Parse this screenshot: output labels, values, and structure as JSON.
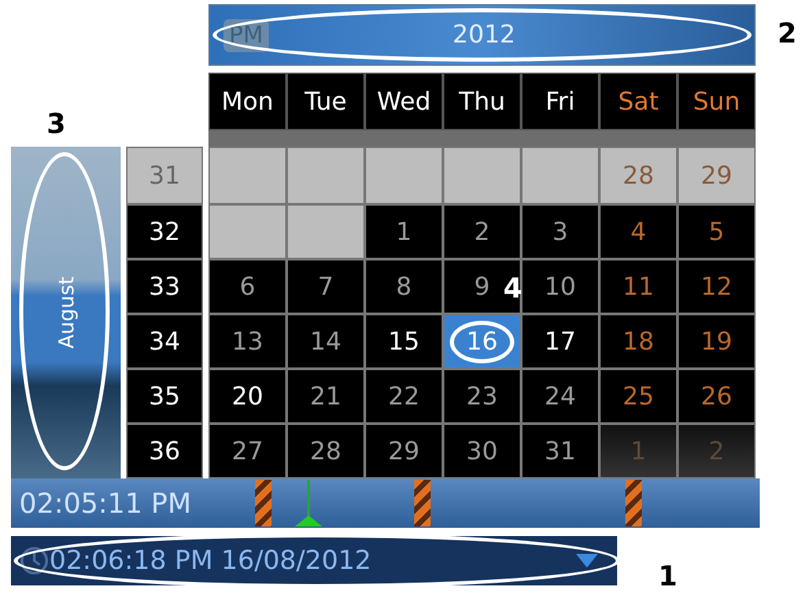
{
  "year_bar": {
    "am_pm": "PM",
    "year": "2012"
  },
  "weekdays": [
    {
      "label": "Mon",
      "kind": "weekday"
    },
    {
      "label": "Tue",
      "kind": "weekday"
    },
    {
      "label": "Wed",
      "kind": "weekday"
    },
    {
      "label": "Thu",
      "kind": "weekday"
    },
    {
      "label": "Fri",
      "kind": "weekday"
    },
    {
      "label": "Sat",
      "kind": "weekend"
    },
    {
      "label": "Sun",
      "kind": "weekend"
    }
  ],
  "month": "August",
  "weeks": [
    {
      "number": "31",
      "current": false,
      "days": [
        {
          "kind": "blank",
          "selected": false
        },
        {
          "kind": "blank",
          "selected": false
        },
        {
          "kind": "blank",
          "selected": false
        },
        {
          "kind": "blank",
          "selected": false
        },
        {
          "kind": "blank",
          "selected": false
        },
        {
          "day": "28",
          "kind": "faded",
          "selected": false
        },
        {
          "day": "29",
          "kind": "faded",
          "selected": false
        }
      ]
    },
    {
      "number": "32",
      "current": true,
      "days": [
        {
          "kind": "blank",
          "selected": false
        },
        {
          "kind": "blank",
          "selected": false
        },
        {
          "day": "1",
          "kind": "dim",
          "selected": false
        },
        {
          "day": "2",
          "kind": "dim",
          "selected": false
        },
        {
          "day": "3",
          "kind": "dim",
          "selected": false
        },
        {
          "day": "4",
          "kind": "weekend",
          "selected": false
        },
        {
          "day": "5",
          "kind": "weekend",
          "selected": false
        }
      ]
    },
    {
      "number": "33",
      "current": true,
      "days": [
        {
          "day": "6",
          "kind": "dim",
          "selected": false
        },
        {
          "day": "7",
          "kind": "dim",
          "selected": false
        },
        {
          "day": "8",
          "kind": "dim",
          "selected": false
        },
        {
          "day": "9",
          "kind": "dim",
          "selected": false
        },
        {
          "day": "10",
          "kind": "dim",
          "selected": false
        },
        {
          "day": "11",
          "kind": "weekend",
          "selected": false
        },
        {
          "day": "12",
          "kind": "weekend",
          "selected": false
        }
      ]
    },
    {
      "number": "34",
      "current": true,
      "days": [
        {
          "day": "13",
          "kind": "dim",
          "selected": false
        },
        {
          "day": "14",
          "kind": "dim",
          "selected": false
        },
        {
          "day": "15",
          "kind": "bright",
          "selected": false
        },
        {
          "day": "16",
          "kind": "dim",
          "selected": true
        },
        {
          "day": "17",
          "kind": "bright",
          "selected": false
        },
        {
          "day": "18",
          "kind": "weekend",
          "selected": false
        },
        {
          "day": "19",
          "kind": "weekend",
          "selected": false
        }
      ]
    },
    {
      "number": "35",
      "current": true,
      "days": [
        {
          "day": "20",
          "kind": "bright",
          "selected": false
        },
        {
          "day": "21",
          "kind": "dim",
          "selected": false
        },
        {
          "day": "22",
          "kind": "dim",
          "selected": false
        },
        {
          "day": "23",
          "kind": "dim",
          "selected": false
        },
        {
          "day": "24",
          "kind": "dim",
          "selected": false
        },
        {
          "day": "25",
          "kind": "weekend",
          "selected": false
        },
        {
          "day": "26",
          "kind": "weekend",
          "selected": false
        }
      ]
    },
    {
      "number": "36",
      "current": true,
      "days": [
        {
          "day": "27",
          "kind": "dim",
          "selected": false
        },
        {
          "day": "28",
          "kind": "dim",
          "selected": false
        },
        {
          "day": "29",
          "kind": "dim",
          "selected": false
        },
        {
          "day": "30",
          "kind": "dim",
          "selected": false
        },
        {
          "day": "31",
          "kind": "dim",
          "selected": false
        },
        {
          "day": "1",
          "kind": "outside",
          "selected": false
        },
        {
          "day": "2",
          "kind": "outside",
          "selected": false
        }
      ]
    }
  ],
  "time_bar": {
    "time": "02:05:11 PM"
  },
  "date_field": {
    "value": "02:06:18 PM 16/08/2012"
  },
  "callouts": [
    {
      "label": "1"
    },
    {
      "label": "2"
    },
    {
      "label": "3"
    },
    {
      "label": "4"
    }
  ]
}
